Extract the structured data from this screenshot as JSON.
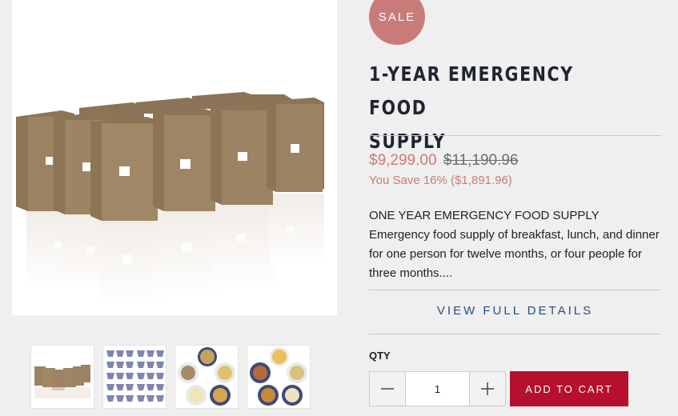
{
  "product": {
    "badge": "SALE",
    "title_line1": "1-YEAR EMERGENCY FOOD",
    "title_line2": "SUPPLY",
    "price": "$9,299.00",
    "compare_price": "$11,190.96",
    "savings": "You Save 16% ($1,891.96)",
    "description_heading": "ONE YEAR EMERGENCY FOOD SUPPLY",
    "description_line1": "Emergency food supply of breakfast, lunch, and dinner",
    "description_line2": "for one person for twelve months, or four people for",
    "description_line3": "three months....",
    "details_link": "VIEW FULL DETAILS"
  },
  "purchase": {
    "qty_label": "QTY",
    "qty_value": "1",
    "decrease_icon": "minus-icon",
    "increase_icon": "plus-icon",
    "add_to_cart": "ADD TO CART"
  },
  "gallery": {
    "thumbnails": [
      "boxes",
      "pouches",
      "meals-plate-1",
      "meals-plate-2"
    ]
  },
  "colors": {
    "sale": "#c97b79",
    "title": "#1f2430",
    "link": "#2a4d7f",
    "cart_button": "#b5102d"
  }
}
